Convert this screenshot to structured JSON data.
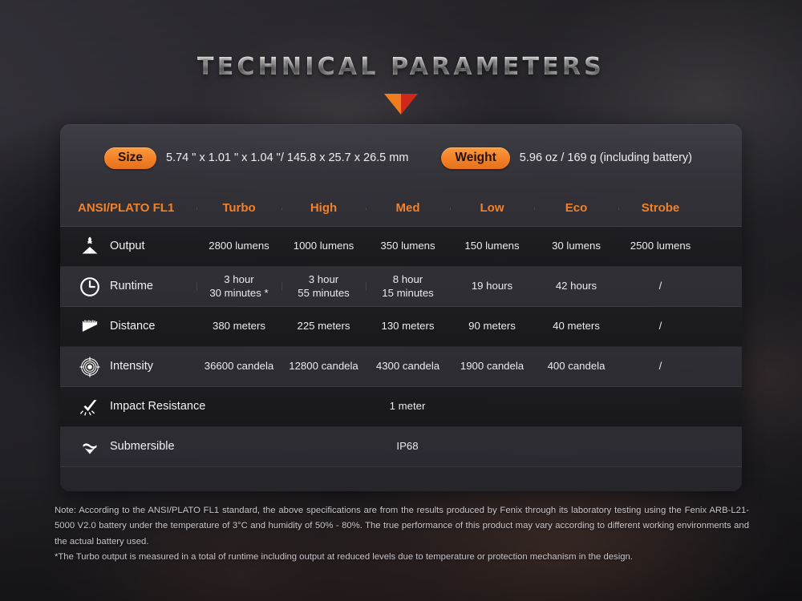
{
  "page": {
    "title": "TECHNICAL PARAMETERS",
    "accent_orange": "#f0812a",
    "chevron_left_color": "#f07d1e",
    "chevron_right_color": "#cf2718"
  },
  "summary": {
    "size": {
      "pill": "Size",
      "value": "5.74 \" x 1.01 \" x 1.04 \"/ 145.8 x 25.7 x 26.5 mm"
    },
    "weight": {
      "pill": "Weight",
      "value": "5.96 oz / 169 g (including battery)"
    }
  },
  "table": {
    "headers": [
      "ANSI/PLATO FL1",
      "Turbo",
      "High",
      "Med",
      "Low",
      "Eco",
      "Strobe"
    ],
    "rows": [
      {
        "icon": "sunburst-icon",
        "label": "Output",
        "values": [
          "2800 lumens",
          "1000 lumens",
          "350 lumens",
          "150 lumens",
          "30 lumens",
          "2500 lumens"
        ]
      },
      {
        "icon": "clock-icon",
        "label": "Runtime",
        "values_line1": [
          "3 hour",
          "3 hour",
          "8 hour",
          "19 hours",
          "42 hours",
          "/"
        ],
        "values_line2": [
          "30 minutes *",
          "55 minutes",
          "15 minutes",
          "",
          "",
          ""
        ]
      },
      {
        "icon": "beam-ruler-icon",
        "label": "Distance",
        "values": [
          "380 meters",
          "225 meters",
          "130 meters",
          "90 meters",
          "40 meters",
          "/"
        ]
      },
      {
        "icon": "target-icon",
        "label": "Intensity",
        "values": [
          "36600 candela",
          "12800 candela",
          "4300 candela",
          "1900 candela",
          "400 candela",
          "/"
        ]
      }
    ],
    "full_width_rows": [
      {
        "icon": "impact-check-icon",
        "label": "Impact Resistance",
        "value": "1 meter"
      },
      {
        "icon": "water-waves-icon",
        "label": "Submersible",
        "value": "IP68"
      }
    ]
  },
  "note": {
    "line1": "Note: According to the ANSI/PLATO FL1 standard, the above specifications are from the results produced by Fenix through its laboratory testing using the Fenix ARB-L21-5000 V2.0 battery under the temperature of 3°C and humidity of 50% - 80%. The true performance of this product may vary according to different working environments and the actual battery used.",
    "line2": "*The Turbo output is measured in a total of runtime including output at reduced levels due to temperature or protection mechanism in the design."
  }
}
